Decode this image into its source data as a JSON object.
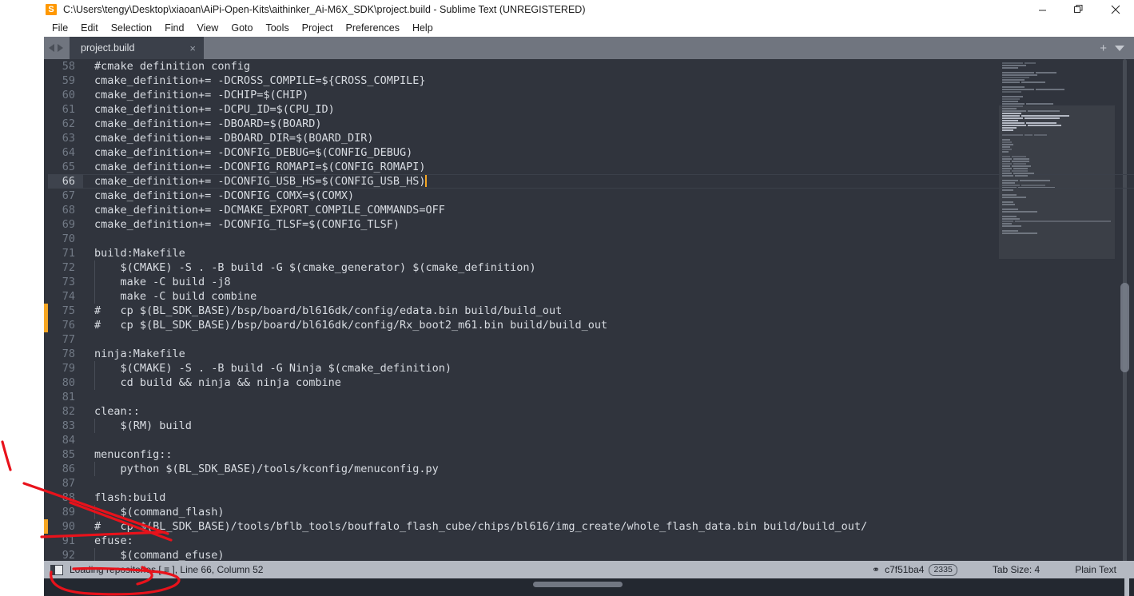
{
  "window": {
    "title": "C:\\Users\\tengy\\Desktop\\xiaoan\\AiPi-Open-Kits\\aithinker_Ai-M6X_SDK\\project.build - Sublime Text (UNREGISTERED)",
    "app_icon": "sublime-text-icon",
    "controls": {
      "minimize": "minimize-icon",
      "restore": "restore-icon",
      "close": "close-icon"
    }
  },
  "menubar": {
    "items": [
      {
        "label": "File"
      },
      {
        "label": "Edit"
      },
      {
        "label": "Selection"
      },
      {
        "label": "Find"
      },
      {
        "label": "View"
      },
      {
        "label": "Goto"
      },
      {
        "label": "Tools"
      },
      {
        "label": "Project"
      },
      {
        "label": "Preferences"
      },
      {
        "label": "Help"
      }
    ]
  },
  "tabbar": {
    "nav_prev": "arrow-left-icon",
    "nav_next": "arrow-right-icon",
    "tabs": [
      {
        "label": "project.build",
        "close": "×",
        "active": true
      }
    ],
    "new_tab": "+",
    "tab_menu": "chevron-down-icon"
  },
  "editor": {
    "active_line_number": 66,
    "cursor_column": 52,
    "modified_markers": [
      75,
      76,
      90
    ],
    "lines": [
      {
        "n": "58",
        "text": "#cmake definition config"
      },
      {
        "n": "59",
        "text": "cmake_definition+= -DCROSS_COMPILE=${CROSS_COMPILE}"
      },
      {
        "n": "60",
        "text": "cmake_definition+= -DCHIP=$(CHIP)"
      },
      {
        "n": "61",
        "text": "cmake_definition+= -DCPU_ID=$(CPU_ID)"
      },
      {
        "n": "62",
        "text": "cmake_definition+= -DBOARD=$(BOARD)"
      },
      {
        "n": "63",
        "text": "cmake_definition+= -DBOARD_DIR=$(BOARD_DIR)"
      },
      {
        "n": "64",
        "text": "cmake_definition+= -DCONFIG_DEBUG=$(CONFIG_DEBUG)"
      },
      {
        "n": "65",
        "text": "cmake_definition+= -DCONFIG_ROMAPI=$(CONFIG_ROMAPI)"
      },
      {
        "n": "66",
        "text": "cmake_definition+= -DCONFIG_USB_HS=$(CONFIG_USB_HS)"
      },
      {
        "n": "67",
        "text": "cmake_definition+= -DCONFIG_COMX=$(COMX)"
      },
      {
        "n": "68",
        "text": "cmake_definition+= -DCMAKE_EXPORT_COMPILE_COMMANDS=OFF"
      },
      {
        "n": "69",
        "text": "cmake_definition+= -DCONFIG_TLSF=$(CONFIG_TLSF)"
      },
      {
        "n": "70",
        "text": ""
      },
      {
        "n": "71",
        "text": "build:Makefile"
      },
      {
        "n": "72",
        "text": "    $(CMAKE) -S . -B build -G $(cmake_generator) $(cmake_definition)"
      },
      {
        "n": "73",
        "text": "    make -C build -j8"
      },
      {
        "n": "74",
        "text": "    make -C build combine"
      },
      {
        "n": "75",
        "text": "#   cp $(BL_SDK_BASE)/bsp/board/bl616dk/config/edata.bin build/build_out"
      },
      {
        "n": "76",
        "text": "#   cp $(BL_SDK_BASE)/bsp/board/bl616dk/config/Rx_boot2_m61.bin build/build_out"
      },
      {
        "n": "77",
        "text": ""
      },
      {
        "n": "78",
        "text": "ninja:Makefile"
      },
      {
        "n": "79",
        "text": "    $(CMAKE) -S . -B build -G Ninja $(cmake_definition)"
      },
      {
        "n": "80",
        "text": "    cd build && ninja && ninja combine"
      },
      {
        "n": "81",
        "text": ""
      },
      {
        "n": "82",
        "text": "clean::"
      },
      {
        "n": "83",
        "text": "    $(RM) build"
      },
      {
        "n": "84",
        "text": ""
      },
      {
        "n": "85",
        "text": "menuconfig::"
      },
      {
        "n": "86",
        "text": "    python $(BL_SDK_BASE)/tools/kconfig/menuconfig.py"
      },
      {
        "n": "87",
        "text": ""
      },
      {
        "n": "88",
        "text": "flash:build"
      },
      {
        "n": "89",
        "text": "    $(command_flash)"
      },
      {
        "n": "90",
        "text": "#   cp $(BL_SDK_BASE)/tools/bflb_tools/bouffalo_flash_cube/chips/bl616/img_create/whole_flash_data.bin build/build_out/"
      },
      {
        "n": "91",
        "text": "efuse:"
      },
      {
        "n": "92",
        "text": "    $(command_efuse)"
      }
    ]
  },
  "statusbar": {
    "icon": "sidebar-toggle-icon",
    "message": "Loading repositories [ ≡  ], Line 66, Column 52",
    "branch_icon": "git-branch-icon",
    "branch": "c7f51ba4",
    "branch_badge": "2335",
    "tab_size": "Tab Size: 4",
    "syntax": "Plain Text"
  },
  "colors": {
    "editor_bg": "#30343d",
    "tabbar_bg": "#70757f",
    "tab_active_bg": "#3b404a",
    "statusbar_bg": "#b4b9c2",
    "accent_orange": "#f5a623",
    "text": "#d8dce2",
    "line_number": "#727a86",
    "annotation_red": "#e8121b"
  },
  "annotations": {
    "color": "#e8121b",
    "shapes": [
      "arrow-to-line-90",
      "ellipse-around-loading-repositories"
    ]
  }
}
